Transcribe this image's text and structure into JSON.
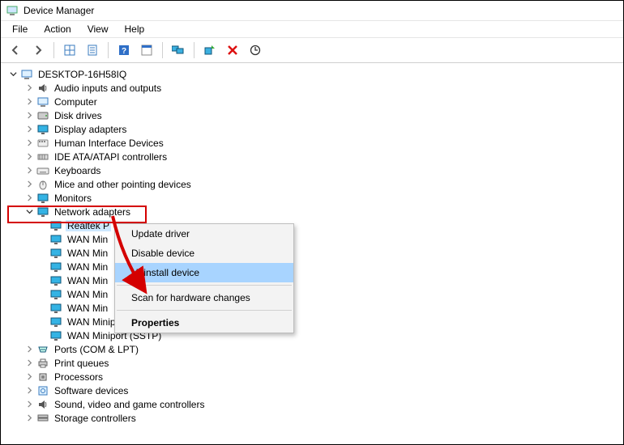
{
  "title": "Device Manager",
  "menubar": [
    "File",
    "Action",
    "View",
    "Help"
  ],
  "toolbar_icons": [
    "back-icon",
    "forward-icon",
    "sep",
    "show-hidden-icon",
    "properties-icon",
    "sep",
    "help-icon",
    "props2-icon",
    "sep",
    "monitors-icon",
    "sep",
    "scan-icon",
    "delete-icon",
    "update-icon"
  ],
  "root": "DESKTOP-16H58IQ",
  "categories": [
    {
      "label": "Audio inputs and outputs",
      "icon": "audio"
    },
    {
      "label": "Computer",
      "icon": "computer"
    },
    {
      "label": "Disk drives",
      "icon": "disk"
    },
    {
      "label": "Display adapters",
      "icon": "display"
    },
    {
      "label": "Human Interface Devices",
      "icon": "hid"
    },
    {
      "label": "IDE ATA/ATAPI controllers",
      "icon": "ide"
    },
    {
      "label": "Keyboards",
      "icon": "keyboard"
    },
    {
      "label": "Mice and other pointing devices",
      "icon": "mouse"
    },
    {
      "label": "Monitors",
      "icon": "display"
    },
    {
      "label": "Network adapters",
      "icon": "display",
      "expanded": true,
      "highlighted": true,
      "children": [
        {
          "label": "Realtek P",
          "selected": true
        },
        {
          "label": "WAN Min"
        },
        {
          "label": "WAN Min"
        },
        {
          "label": "WAN Min"
        },
        {
          "label": "WAN Min"
        },
        {
          "label": "WAN Min"
        },
        {
          "label": "WAN Min"
        },
        {
          "label": "WAN Miniport (PPTP)"
        },
        {
          "label": "WAN Miniport (SSTP)"
        }
      ]
    },
    {
      "label": "Ports (COM & LPT)",
      "icon": "port"
    },
    {
      "label": "Print queues",
      "icon": "printer"
    },
    {
      "label": "Processors",
      "icon": "cpu"
    },
    {
      "label": "Software devices",
      "icon": "software"
    },
    {
      "label": "Sound, video and game controllers",
      "icon": "audio"
    },
    {
      "label": "Storage controllers",
      "icon": "storage"
    }
  ],
  "context_menu": {
    "items": [
      {
        "label": "Update driver"
      },
      {
        "label": "Disable device"
      },
      {
        "label": "Uninstall device",
        "hover": true
      },
      {
        "sep": true
      },
      {
        "label": "Scan for hardware changes"
      },
      {
        "sep": true
      },
      {
        "label": "Properties",
        "bold": true
      }
    ]
  }
}
